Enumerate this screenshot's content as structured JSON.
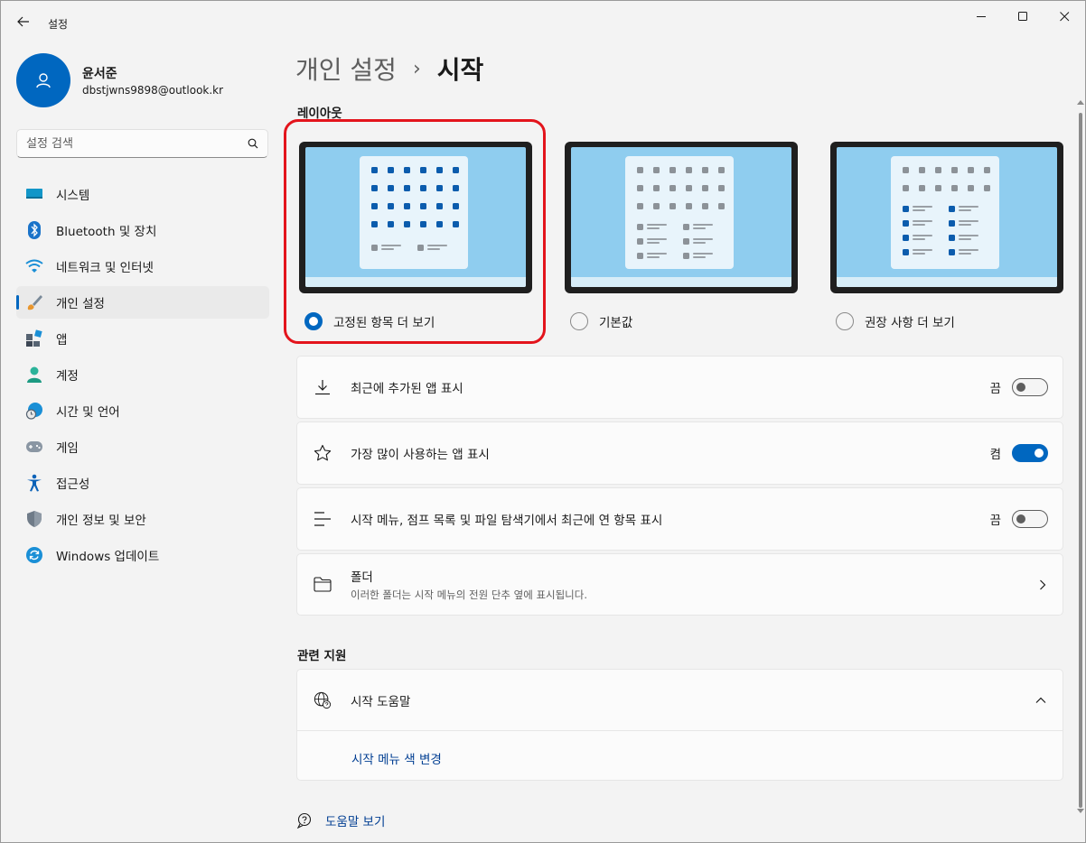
{
  "window": {
    "title": "설정"
  },
  "profile": {
    "name": "윤서준",
    "email": "dbstjwns9898@outlook.kr"
  },
  "search": {
    "placeholder": "설정 검색"
  },
  "sidebar": {
    "items": [
      {
        "label": "시스템",
        "icon": "system-icon"
      },
      {
        "label": "Bluetooth 및 장치",
        "icon": "bluetooth-icon"
      },
      {
        "label": "네트워크 및 인터넷",
        "icon": "wifi-icon"
      },
      {
        "label": "개인 설정",
        "icon": "brush-icon",
        "active": true
      },
      {
        "label": "앱",
        "icon": "apps-icon"
      },
      {
        "label": "계정",
        "icon": "account-icon"
      },
      {
        "label": "시간 및 언어",
        "icon": "time-language-icon"
      },
      {
        "label": "게임",
        "icon": "gamepad-icon"
      },
      {
        "label": "접근성",
        "icon": "accessibility-icon"
      },
      {
        "label": "개인 정보 및 보안",
        "icon": "shield-icon"
      },
      {
        "label": "Windows 업데이트",
        "icon": "update-icon"
      }
    ]
  },
  "breadcrumb": {
    "parent": "개인 설정",
    "separator": "›",
    "current": "시작"
  },
  "layout": {
    "title": "레이아웃",
    "options": [
      {
        "label": "고정된 항목 더 보기",
        "selected": true
      },
      {
        "label": "기본값",
        "selected": false
      },
      {
        "label": "권장 사항 더 보기",
        "selected": false
      }
    ]
  },
  "settings": [
    {
      "label": "최근에 추가된 앱 표시",
      "state": "끔",
      "on": false,
      "icon": "download-icon"
    },
    {
      "label": "가장 많이 사용하는 앱 표시",
      "state": "켬",
      "on": true,
      "icon": "star-icon"
    },
    {
      "label": "시작 메뉴, 점프 목록 및 파일 탐색기에서 최근에 연 항목 표시",
      "state": "끔",
      "on": false,
      "icon": "list-icon"
    }
  ],
  "folders": {
    "label": "폴더",
    "sub": "이러한 폴더는 시작 메뉴의 전원 단추 옆에 표시됩니다."
  },
  "support": {
    "title": "관련 지원",
    "help_title": "시작 도움말",
    "link": "시작 메뉴 색 변경"
  },
  "help": {
    "label": "도움말 보기"
  },
  "colors": {
    "accent": "#0067c0",
    "highlight": "#e3141c",
    "link": "#003e92"
  }
}
